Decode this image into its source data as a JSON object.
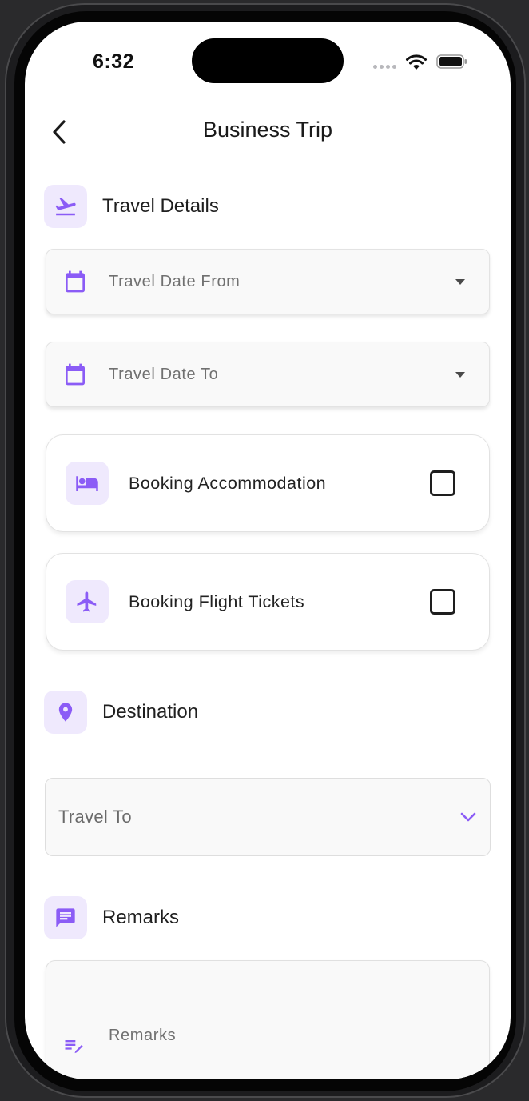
{
  "status_bar": {
    "time": "6:32"
  },
  "header": {
    "title": "Business Trip"
  },
  "sections": {
    "travel_details": "Travel Details",
    "destination": "Destination",
    "remarks": "Remarks"
  },
  "travel_date_from": {
    "label": "Travel Date From"
  },
  "travel_date_to": {
    "label": "Travel Date To"
  },
  "booking_accommodation": {
    "label": "Booking Accommodation",
    "checked": false
  },
  "booking_flight": {
    "label": "Booking Flight Tickets",
    "checked": false
  },
  "travel_to": {
    "placeholder": "Travel To"
  },
  "remarks_field": {
    "placeholder": "Remarks"
  },
  "colors": {
    "accent": "#8b5cf6",
    "icon_bg": "#efe9fd"
  },
  "icons": {
    "back": "chevron-left-icon",
    "travel": "flight-takeoff-icon",
    "calendar": "calendar-icon",
    "hotel": "bed-icon",
    "flight": "airplane-icon",
    "destination": "location-pin-icon",
    "remarks": "chat-message-icon",
    "remarks_field": "edit-note-icon"
  }
}
